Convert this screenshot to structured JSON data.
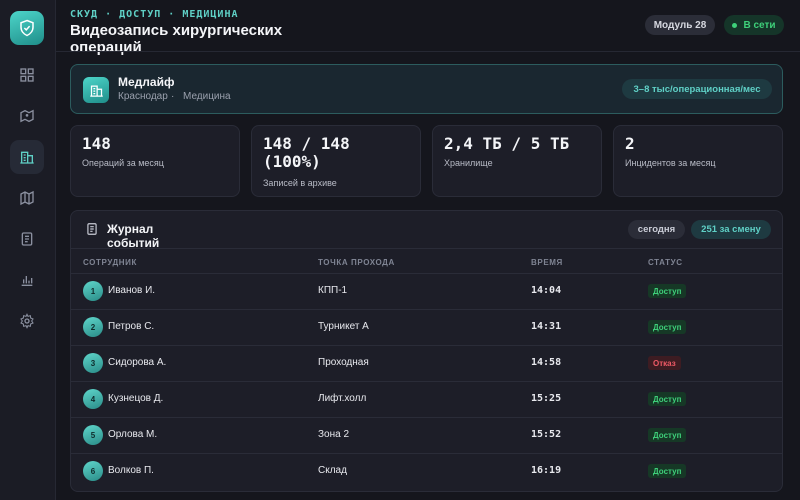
{
  "header": {
    "kicker": "СКУД · ДОСТУП · МЕДИЦИНА",
    "title": "Видеозапись хирургических операций",
    "module_badge": "Модуль 28",
    "status_badge": "В сети"
  },
  "sidebar": {
    "items": [
      {
        "name": "dashboard-icon",
        "active": false
      },
      {
        "name": "map-pin-icon",
        "active": false
      },
      {
        "name": "building-icon",
        "active": true
      },
      {
        "name": "map-icon",
        "active": false
      },
      {
        "name": "document-icon",
        "active": false
      },
      {
        "name": "chart-icon",
        "active": false
      },
      {
        "name": "gear-icon",
        "active": false
      }
    ]
  },
  "clinic": {
    "name": "Медлайф",
    "city": "Краснодар",
    "sector": "Медицина",
    "rate": "3–8 тыс/операционная/мес"
  },
  "stats": [
    {
      "value": "148",
      "label": "Операций за месяц"
    },
    {
      "value": "148 / 148 (100%)",
      "label": "Записей в архиве"
    },
    {
      "value": "2,4 ТБ / 5 ТБ",
      "label": "Хранилище"
    },
    {
      "value": "2",
      "label": "Инцидентов за месяц"
    }
  ],
  "journal": {
    "title": "Журнал событий",
    "filter_today": "сегодня",
    "shift_count": "251 за смену",
    "columns": [
      "СОТРУДНИК",
      "ТОЧКА ПРОХОДА",
      "ВРЕМЯ",
      "СТАТУС"
    ],
    "rows": [
      {
        "num": "1",
        "employee": "Иванов И.",
        "point": "КПП-1",
        "time": "14:04",
        "status": "Доступ",
        "ok": true
      },
      {
        "num": "2",
        "employee": "Петров С.",
        "point": "Турникет А",
        "time": "14:31",
        "status": "Доступ",
        "ok": true
      },
      {
        "num": "3",
        "employee": "Сидорова А.",
        "point": "Проходная",
        "time": "14:58",
        "status": "Отказ",
        "ok": false
      },
      {
        "num": "4",
        "employee": "Кузнецов Д.",
        "point": "Лифт.холл",
        "time": "15:25",
        "status": "Доступ",
        "ok": true
      },
      {
        "num": "5",
        "employee": "Орлова М.",
        "point": "Зона 2",
        "time": "15:52",
        "status": "Доступ",
        "ok": true
      },
      {
        "num": "6",
        "employee": "Волков П.",
        "point": "Склад",
        "time": "16:19",
        "status": "Доступ",
        "ok": true
      }
    ]
  },
  "colors": {
    "accent": "#5fd0c6",
    "ok": "#3ed07a",
    "deny": "#ef5a66",
    "background": "#15161d"
  }
}
